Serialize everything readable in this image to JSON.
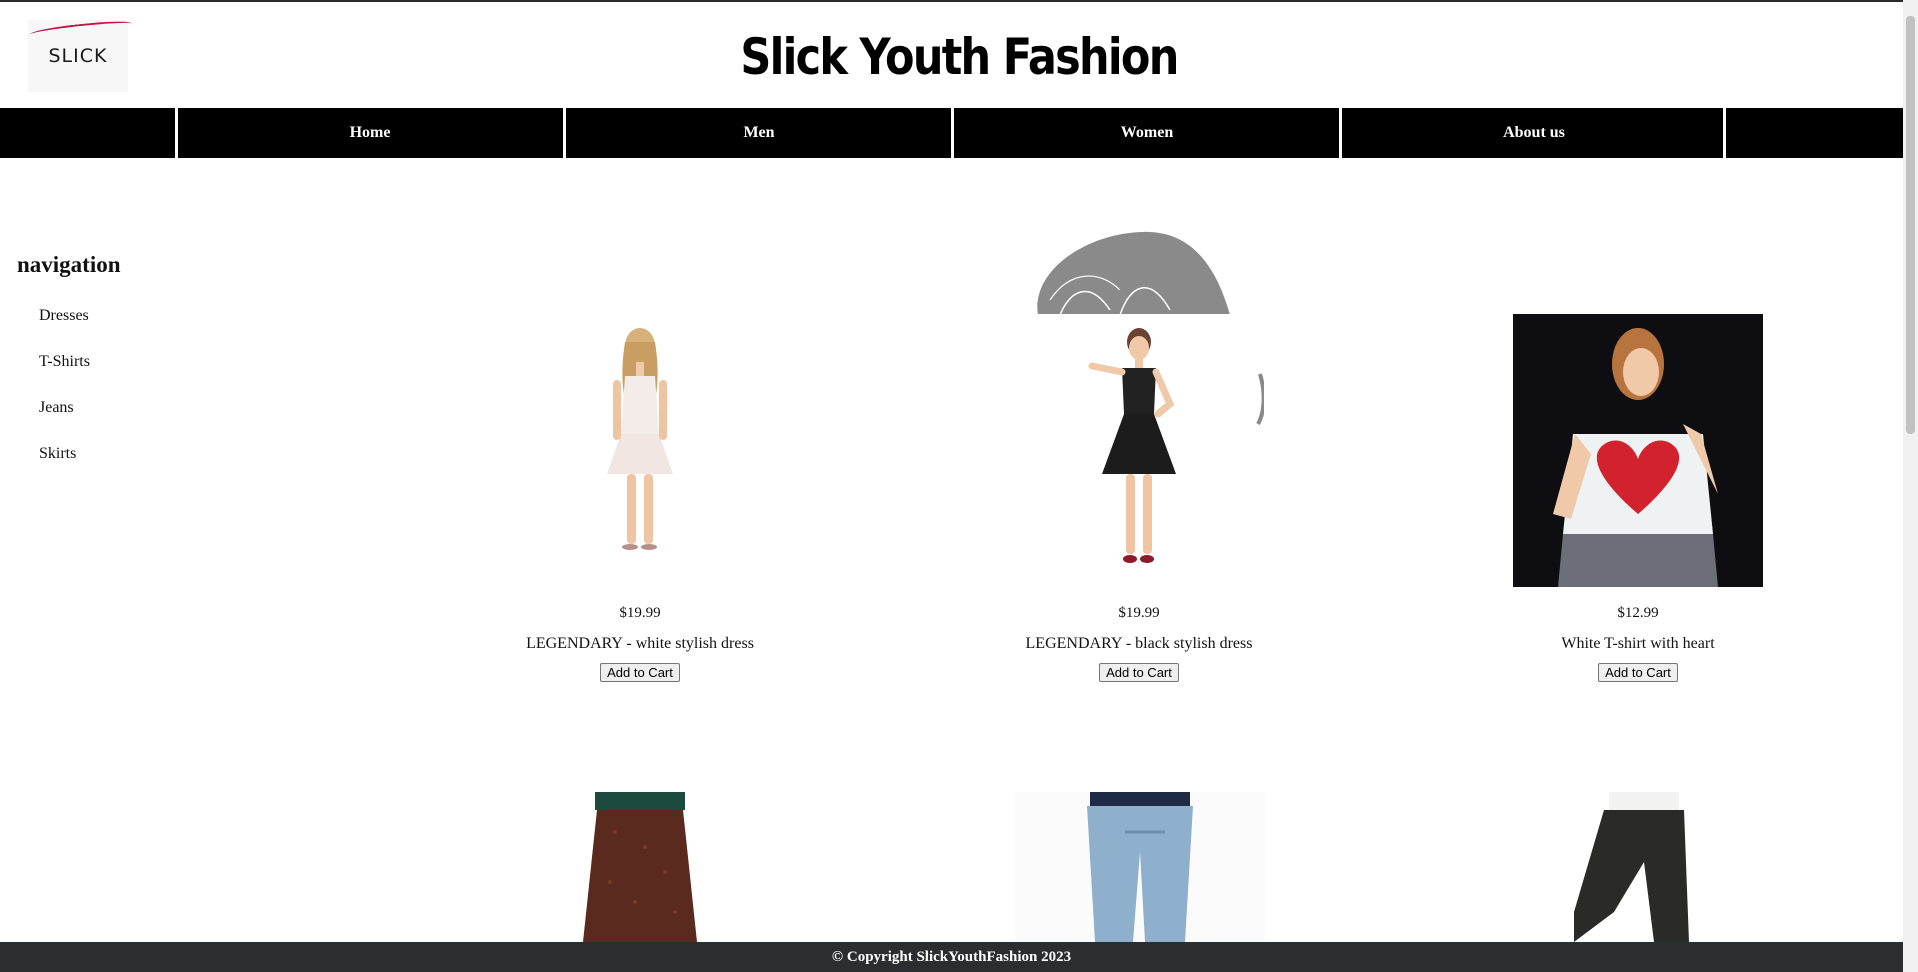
{
  "header": {
    "logo_text": "SLICK",
    "title": "Slick Youth Fashion"
  },
  "nav": {
    "items": [
      {
        "label": "Home"
      },
      {
        "label": "Men"
      },
      {
        "label": "Women"
      },
      {
        "label": "About us"
      }
    ]
  },
  "sidebar": {
    "heading": "navigation",
    "items": [
      {
        "label": "Dresses"
      },
      {
        "label": "T-Shirts"
      },
      {
        "label": "Jeans"
      },
      {
        "label": "Skirts"
      }
    ]
  },
  "products": [
    {
      "price": "$19.99",
      "name": "LEGENDARY - white stylish dress",
      "button": "Add to Cart"
    },
    {
      "price": "$19.99",
      "name": "LEGENDARY - black stylish dress",
      "button": "Add to Cart"
    },
    {
      "price": "$12.99",
      "name": "White T-shirt with heart",
      "button": "Add to Cart"
    }
  ],
  "footer": {
    "text": "© Copyright SlickYouthFashion 2023"
  },
  "colors": {
    "navbar": "#000000",
    "footer": "#2b2e30",
    "logo_accent": "#c0154a"
  }
}
